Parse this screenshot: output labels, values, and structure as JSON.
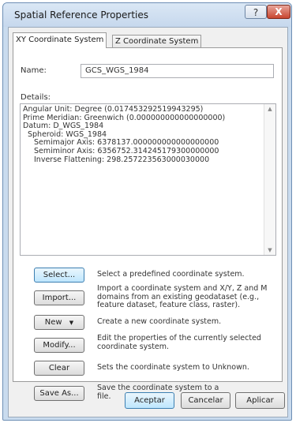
{
  "window": {
    "title": "Spatial Reference Properties",
    "help_label": "?",
    "close_label": "X"
  },
  "tabs": [
    "XY Coordinate System",
    "Z Coordinate System"
  ],
  "name": {
    "label": "Name:",
    "value": "GCS_WGS_1984"
  },
  "details": {
    "label": "Details:",
    "lines": [
      "Angular Unit: Degree (0.017453292519943295)",
      "Prime Meridian: Greenwich (0.000000000000000000)",
      "Datum: D_WGS_1984",
      "  Spheroid: WGS_1984",
      "    Semimajor Axis: 6378137.000000000000000000",
      "    Semiminor Axis: 6356752.314245179300000000",
      "    Inverse Flattening: 298.257223563000030000"
    ]
  },
  "actions": [
    {
      "label": "Select...",
      "description": "Select a predefined coordinate system."
    },
    {
      "label": "Import...",
      "description": "Import a coordinate system and X/Y, Z and M domains from an existing geodataset (e.g., feature dataset, feature class, raster)."
    },
    {
      "label": "New",
      "description": "Create a new coordinate system."
    },
    {
      "label": "Modify...",
      "description": "Edit the properties of the currently selected coordinate system."
    },
    {
      "label": "Clear",
      "description": "Sets the coordinate system to Unknown."
    },
    {
      "label": "Save As...",
      "description": "Save the coordinate system to a file."
    }
  ],
  "footer": {
    "ok": "Aceptar",
    "cancel": "Cancelar",
    "apply": "Aplicar"
  }
}
